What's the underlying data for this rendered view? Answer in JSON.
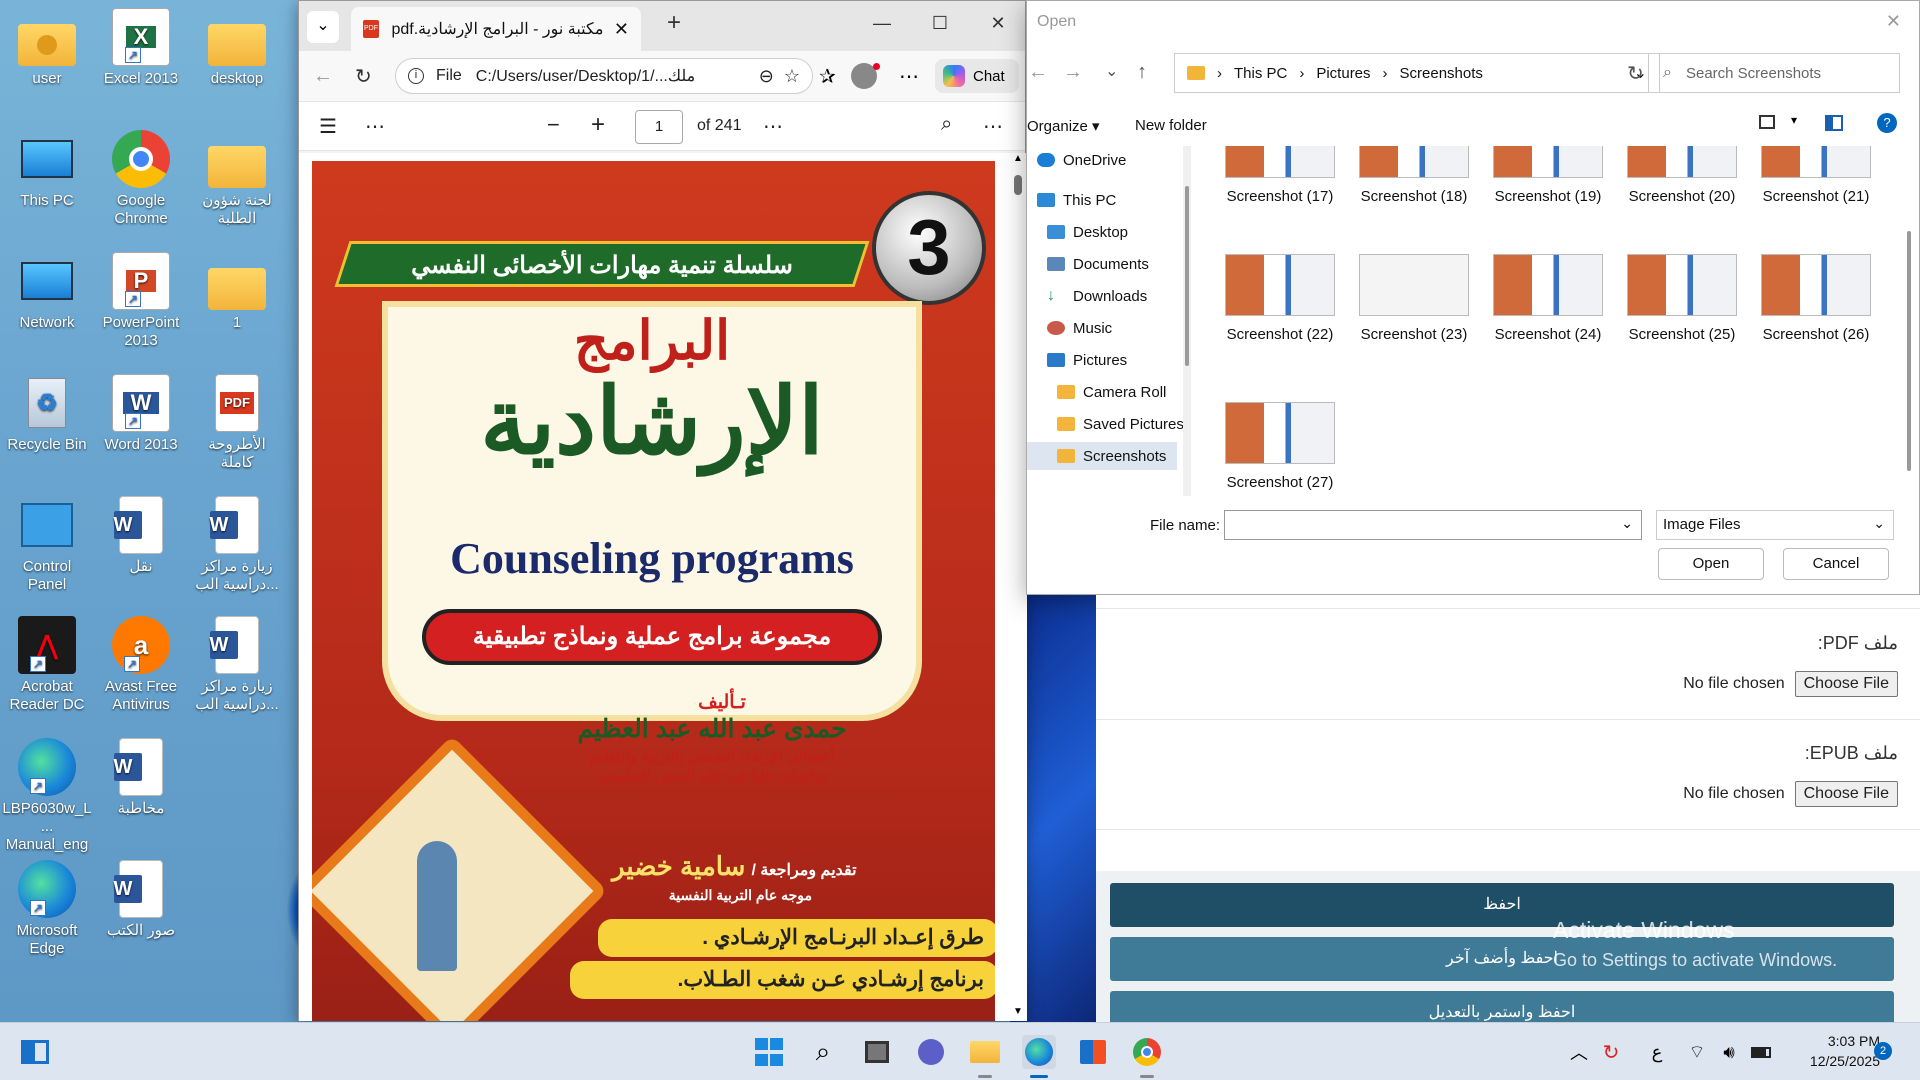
{
  "desktop_icons": [
    {
      "label": "user",
      "icon": "user-folder-icon"
    },
    {
      "label": "Excel 2013",
      "icon": "excel-icon"
    },
    {
      "label": "desktop",
      "icon": "folder-icon"
    },
    {
      "label": "This PC",
      "icon": "monitor-icon"
    },
    {
      "label": "Google Chrome",
      "icon": "chrome-icon"
    },
    {
      "label": "لجنة شؤون الطلبة",
      "icon": "folder-icon"
    },
    {
      "label": "Network",
      "icon": "network-icon"
    },
    {
      "label": "PowerPoint 2013",
      "icon": "powerpoint-icon"
    },
    {
      "label": "1",
      "icon": "folder-icon"
    },
    {
      "label": "Recycle Bin",
      "icon": "recycle-bin-icon"
    },
    {
      "label": "Word 2013",
      "icon": "word-icon"
    },
    {
      "label": "الأطروحة كاملة",
      "icon": "pdf-icon"
    },
    {
      "label": "Control Panel",
      "icon": "control-panel-icon"
    },
    {
      "label": "نقل",
      "icon": "word-doc-icon"
    },
    {
      "label": "زيارة مراكز دراسية الب...",
      "icon": "word-doc-icon"
    },
    {
      "label": "Acrobat Reader DC",
      "icon": "acrobat-icon"
    },
    {
      "label": "Avast Free Antivirus",
      "icon": "avast-icon"
    },
    {
      "label": "زيارة مراكز دراسية الب...",
      "icon": "word-doc-icon"
    },
    {
      "label": "LBP6030w_L... Manual_eng",
      "icon": "edge-icon"
    },
    {
      "label": "مخاطبة",
      "icon": "word-doc-icon"
    },
    {
      "label": "Microsoft Edge",
      "icon": "edge-icon"
    },
    {
      "label": "صور الكتب",
      "icon": "word-doc-icon"
    }
  ],
  "browser": {
    "tab_title": "مكتبة نور - البرامج الإرشادية.pdf",
    "tab_badge": "PDF",
    "url_scheme": "File",
    "url": "C:/Users/user/Desktop/1/...ملك",
    "chat_label": "Chat",
    "page_number": "1",
    "page_total": "of 241"
  },
  "book_cover": {
    "series_number": "3",
    "series_title": "سلسلة تنمية مهارات الأخصائى النفسي",
    "title_top": "البرامج",
    "title_main": "الإرشادية",
    "title_en": "Counseling programs",
    "subtitle": "مجموعة برامج عملية ونماذج تطبيقية",
    "author_label": "تـأليف",
    "author_name": "حمدى عبد الله عبد العظيم",
    "author_line1": "أخصائى الإرشاد النفسي بالتربية والتعليم",
    "author_line2": "دراسات عليا فى علم النفس التطبيقى",
    "reviewer_label": "تقديم ومراجعة /",
    "reviewer_name": "سامية خضير",
    "reviewer_role": "موجه عام التربية النفسية",
    "bullet1": "طرق إعـداد البرنـامج الإرشـادي .",
    "bullet2": "برنامج إرشـادي عـن شغب الطـلاب."
  },
  "open_dialog": {
    "title": "Open",
    "breadcrumb": [
      "This PC",
      "Pictures",
      "Screenshots"
    ],
    "search_placeholder": "Search Screenshots",
    "organize": "Organize",
    "new_folder": "New folder",
    "nav_items": [
      "OneDrive",
      "This PC",
      "Desktop",
      "Documents",
      "Downloads",
      "Music",
      "Pictures",
      "Camera Roll",
      "Saved Pictures",
      "Screenshots"
    ],
    "files": [
      "Screenshot (17)",
      "Screenshot (18)",
      "Screenshot (19)",
      "Screenshot (20)",
      "Screenshot (21)",
      "Screenshot (22)",
      "Screenshot (23)",
      "Screenshot (24)",
      "Screenshot (25)",
      "Screenshot (26)",
      "Screenshot (27)"
    ],
    "file_name_label": "File name:",
    "file_name_value": "",
    "file_type": "Image Files",
    "open_button": "Open",
    "cancel_button": "Cancel"
  },
  "web_form": {
    "pdf_label": "ملف PDF:",
    "epub_label": "ملف EPUB:",
    "no_file": "No file chosen",
    "choose_file": "Choose File",
    "save": "احفظ",
    "save_add": "احفظ وأضف آخر",
    "save_continue": "احفظ واستمر بالتعديل"
  },
  "watermark": {
    "line1": "Activate Windows",
    "line2": "Go to Settings to activate Windows."
  },
  "taskbar": {
    "time": "3:03 PM",
    "date": "12/25/2025",
    "language": "ع",
    "notification_count": "2"
  },
  "colors": {
    "accent": "#0067c0",
    "save_button": "#1f4f66",
    "save_add_button": "#3f7a96"
  }
}
